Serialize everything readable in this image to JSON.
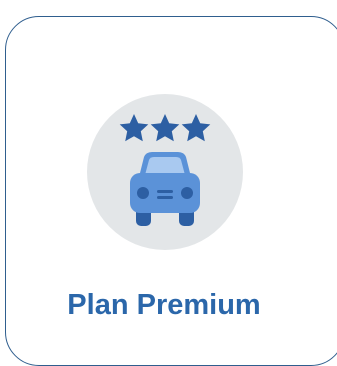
{
  "plan": {
    "title": "Plan Premium",
    "rating_stars": 3,
    "icon": "car-front-icon",
    "star_icon": "star-icon"
  },
  "colors": {
    "title": "#2b67aa",
    "border": "#2f5e8e",
    "badge_bg": "#e3e6e8",
    "star": "#2d5fa3",
    "car_body": "#5b92d8",
    "car_window": "#a9c9f0",
    "car_dark": "#2d5fa3"
  }
}
